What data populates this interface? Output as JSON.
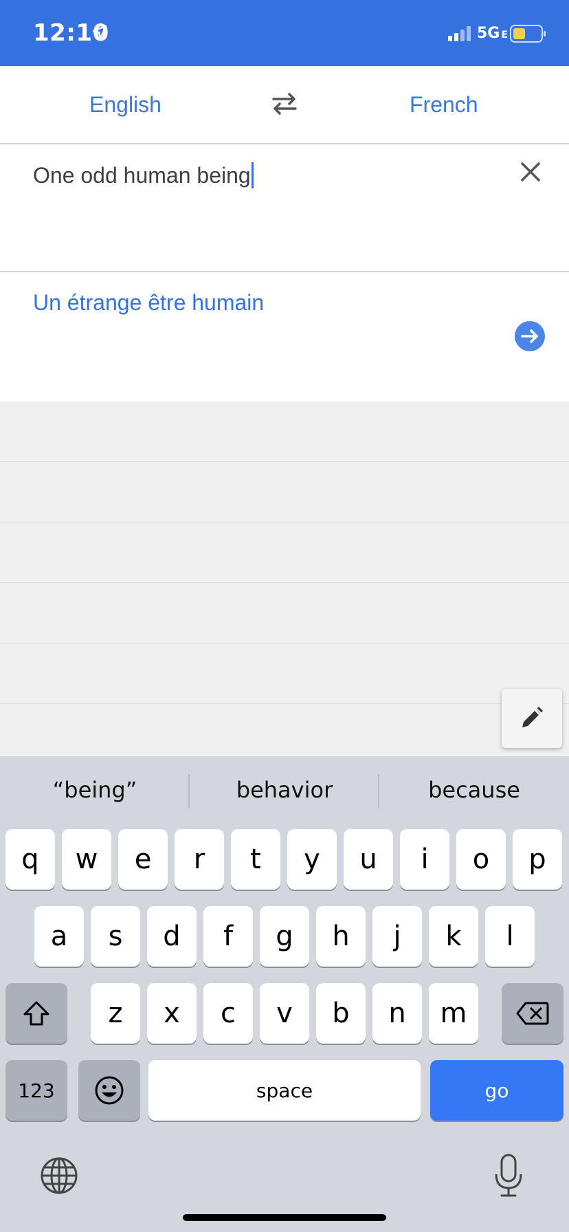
{
  "status": {
    "time": "12:10",
    "network": "5G",
    "network_suffix": "E"
  },
  "languages": {
    "source": "English",
    "target": "French"
  },
  "input": {
    "text": "One odd human being"
  },
  "result": {
    "text": "Un étrange être humain"
  },
  "suggestions": [
    "“being”",
    "behavior",
    "because"
  ],
  "keyboard": {
    "row1": [
      "q",
      "w",
      "e",
      "r",
      "t",
      "y",
      "u",
      "i",
      "o",
      "p"
    ],
    "row2": [
      "a",
      "s",
      "d",
      "f",
      "g",
      "h",
      "j",
      "k",
      "l"
    ],
    "row3": [
      "z",
      "x",
      "c",
      "v",
      "b",
      "n",
      "m"
    ],
    "numbers_key": "123",
    "space_key": "space",
    "go_key": "go"
  },
  "colors": {
    "accent": "#3572e0",
    "go_key": "#3478f6"
  }
}
